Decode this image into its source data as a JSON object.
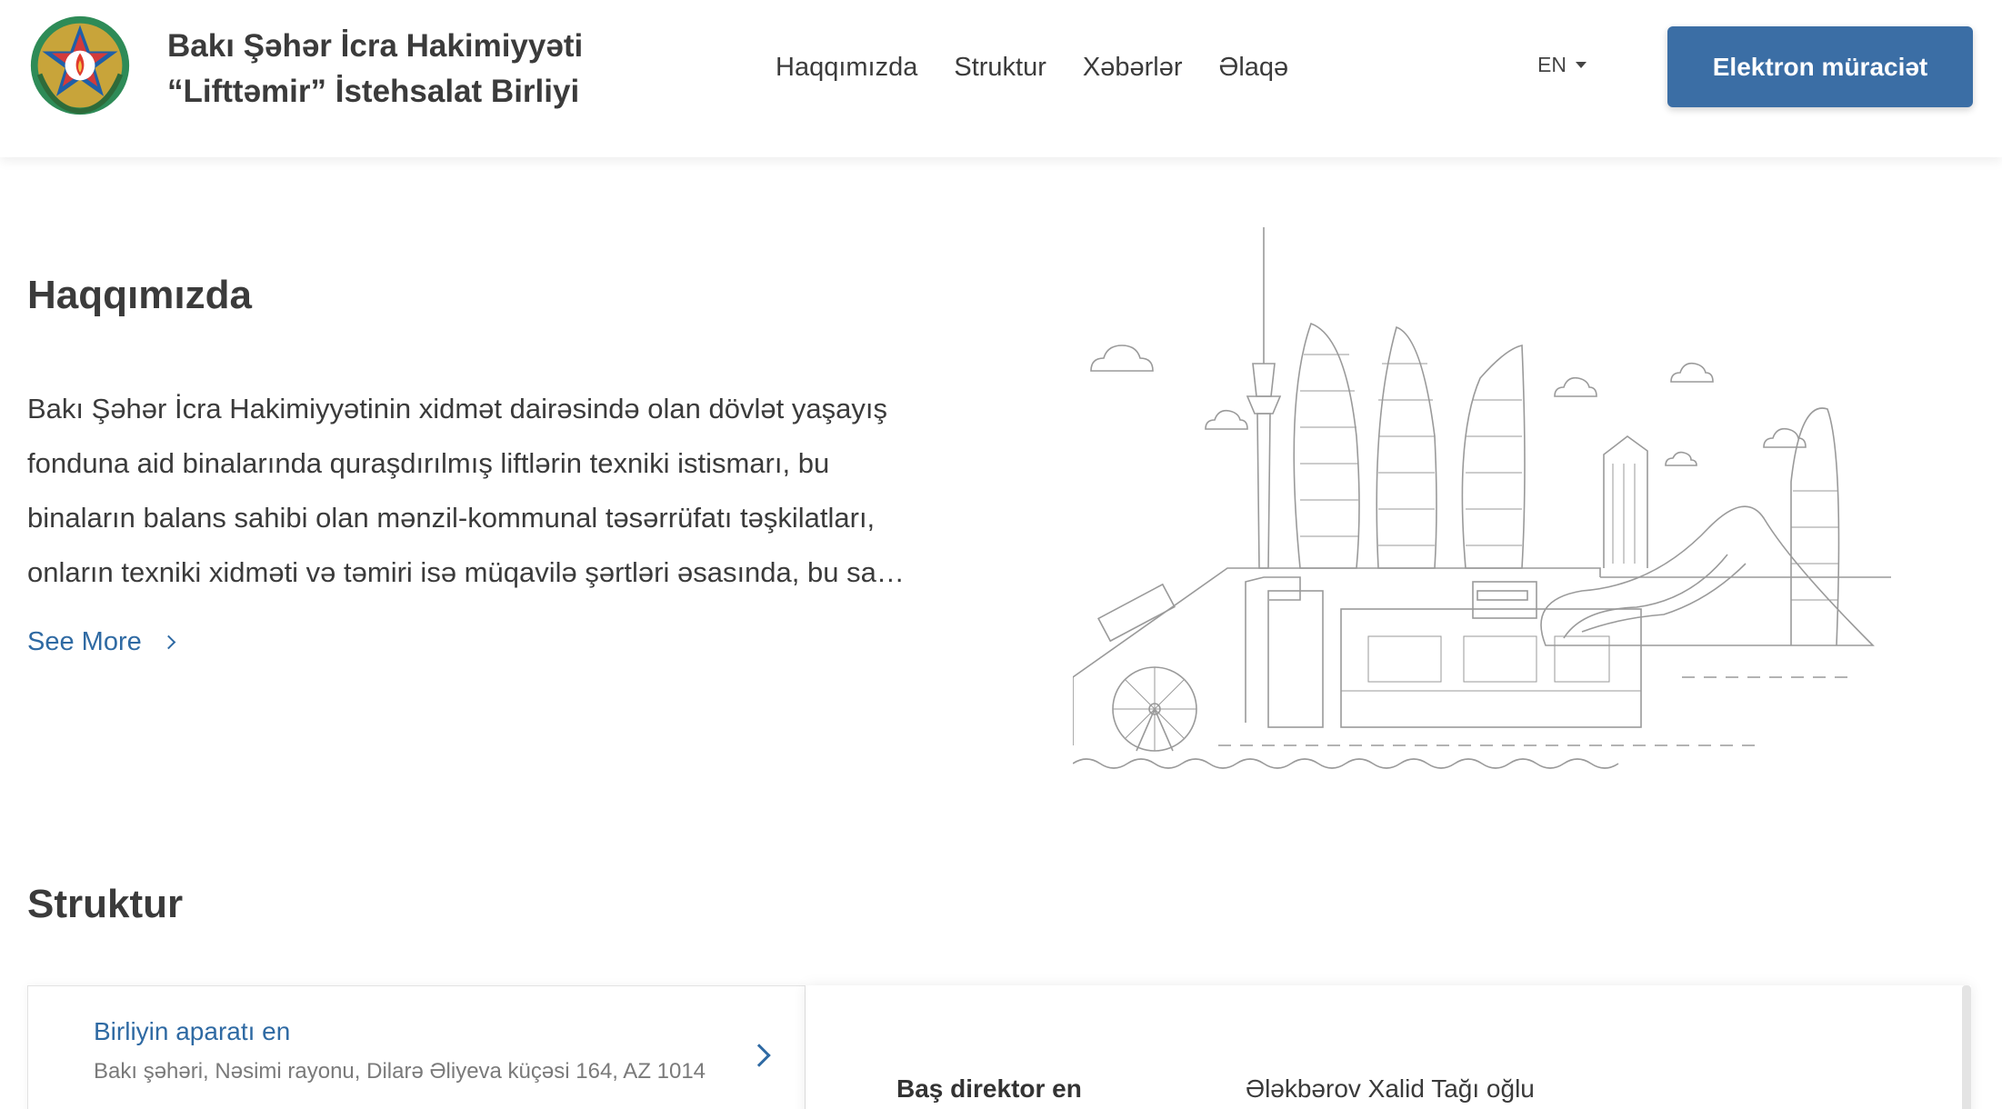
{
  "header": {
    "org_title_line1": "Bakı Şəhər İcra Hakimiyyəti",
    "org_title_line2": "“Lifttəmir” İstehsalat Birliyi",
    "nav": [
      "Haqqımızda",
      "Struktur",
      "Xəbərlər",
      "Əlaqə"
    ],
    "language": "EN",
    "cta_label": "Elektron müraciət"
  },
  "about": {
    "title": "Haqqımızda",
    "text_lines": [
      "Bakı Şəhər İcra Hakimiyyətinin xidmət dairəsində olan dövlət yaşayış",
      "fonduna aid binalarında quraşdırılmış liftlərin texniki istismarı, bu",
      "binaların balans sahibi olan mənzil-kommunal təsərrüfatı təşkilatları,",
      "onların texniki xidməti və təmiri isə müqavilə şərtləri əsasında, bu sa…"
    ],
    "see_more": "See More"
  },
  "structure": {
    "title": "Struktur",
    "unit_name": "Birliyin aparatı en",
    "unit_address": "Bakı şəhəri, Nəsimi rayonu, Dilarə Əliyeva küçəsi 164, AZ 1014",
    "role_label": "Baş direktor en",
    "role_value": "Ələkbərov Xalid Tağı oğlu"
  },
  "colors": {
    "accent": "#3b6ea5",
    "link": "#2f6aa3",
    "text": "#3b3b3b"
  },
  "icons": [
    "emblem",
    "caret-down-icon",
    "chevron-right-icon",
    "skyline-illustration"
  ]
}
